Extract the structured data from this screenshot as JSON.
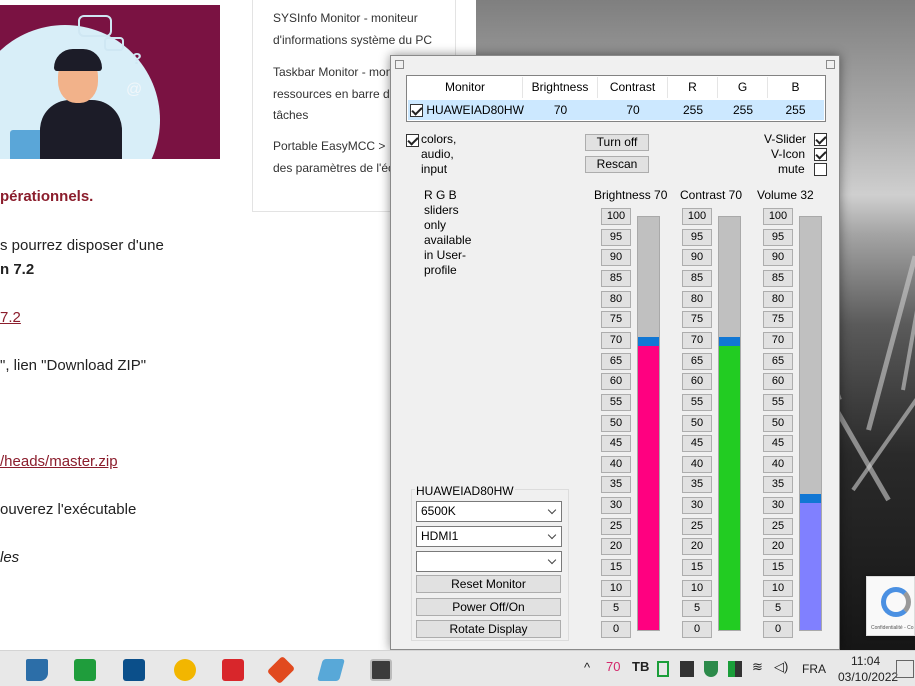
{
  "webpage": {
    "text_lines": [
      {
        "id": "operationnels",
        "text": "pérationnels.",
        "style": "red"
      },
      {
        "id": "disposer",
        "text": "s pourrez disposer d'une",
        "style": "normal"
      },
      {
        "id": "version",
        "text": "n 7.2",
        "style": "bold"
      },
      {
        "id": "link72",
        "text": "7.2",
        "style": "link"
      },
      {
        "id": "download",
        "text": "\", lien \"Download ZIP\"",
        "style": "normal"
      },
      {
        "id": "masterzip",
        "text": "/heads/master.zip",
        "style": "link"
      },
      {
        "id": "executable",
        "text": "ouverez l'exécutable",
        "style": "normal"
      },
      {
        "id": "les",
        "text": "les",
        "style": "ital"
      }
    ],
    "sidebar": {
      "item1": "SYSInfo Monitor - moniteur",
      "item1b": "d'informations système du PC",
      "item2": "Taskbar Monitor - moni",
      "item2b": "ressources en barre d",
      "item2c": "tâches",
      "item3": "Portable EasyMCC > ",
      "item3b": "des paramètres de l'éc"
    }
  },
  "app": {
    "table": {
      "headers": [
        "Monitor",
        "Brightness",
        "Contrast",
        "R",
        "G",
        "B"
      ],
      "row": {
        "checked": true,
        "monitor": "HUAWEIAD80HW",
        "brightness": "70",
        "contrast": "70",
        "r": "255",
        "g": "255",
        "b": "255"
      }
    },
    "options_left": {
      "checked": true,
      "label_line1": "colors,",
      "label_line2": "audio,",
      "label_line3": "input"
    },
    "buttons": {
      "turn_off": "Turn off",
      "rescan": "Rescan",
      "reset_monitor": "Reset Monitor",
      "power": "Power Off/On",
      "rotate": "Rotate Display"
    },
    "options_right": [
      {
        "label": "V-Slider",
        "checked": true
      },
      {
        "label": "V-Icon",
        "checked": true
      },
      {
        "label": "mute",
        "checked": false
      }
    ],
    "rgb_note": [
      "R G B",
      "sliders",
      "only",
      "available",
      "in User-",
      "profile"
    ],
    "sliders": [
      {
        "id": "brightness",
        "label": "Brightness 70",
        "value": 70,
        "color": "#ff0080"
      },
      {
        "id": "contrast",
        "label": "Contrast 70",
        "value": 70,
        "color": "#22cc22"
      },
      {
        "id": "volume",
        "label": "Volume 32",
        "value": 32,
        "color": "#8080ff"
      }
    ],
    "step_labels": [
      "100",
      "95",
      "90",
      "85",
      "80",
      "75",
      "70",
      "65",
      "60",
      "55",
      "50",
      "45",
      "40",
      "35",
      "30",
      "25",
      "20",
      "15",
      "10",
      "5",
      "0"
    ],
    "device_group": {
      "title": "HUAWEIAD80HW",
      "color_temp": "6500K",
      "input": "HDMI1",
      "third": ""
    }
  },
  "taskbar": {
    "tray_number": "70",
    "language": "FRA",
    "time": "11:04",
    "date": "03/10/2022"
  },
  "recaptcha": {
    "text": "Confidentialité - Co"
  }
}
